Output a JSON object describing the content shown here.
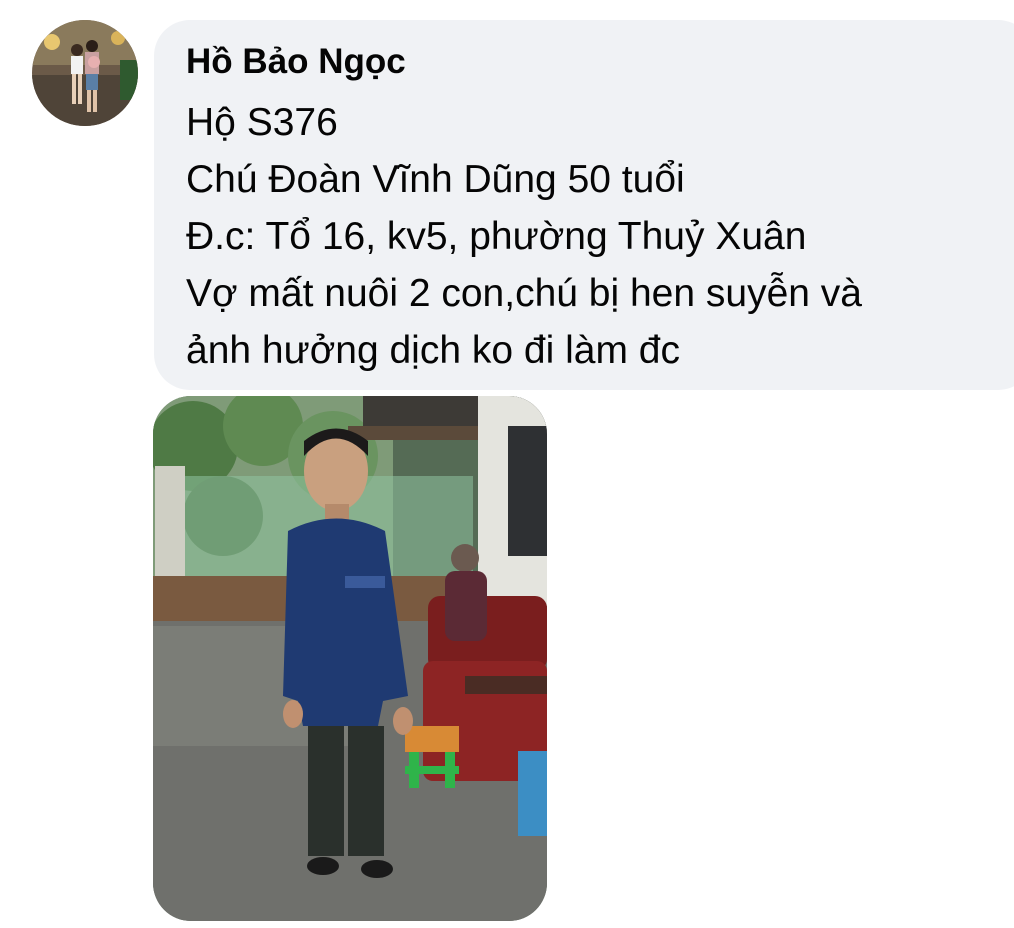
{
  "comment": {
    "author": "Hồ Bảo Ngọc",
    "lines": [
      "Hộ S376",
      "Chú Đoàn Vĩnh Dũng 50 tuổi",
      "Đ.c: Tổ 16, kv5, phường Thuỷ Xuân",
      "Vợ mất nuôi 2 con,chú bị hen suyễn và",
      "ảnh hưởng dịch ko đi làm đc"
    ],
    "bubble_color": "#f0f2f5",
    "text_color": "#050505"
  }
}
